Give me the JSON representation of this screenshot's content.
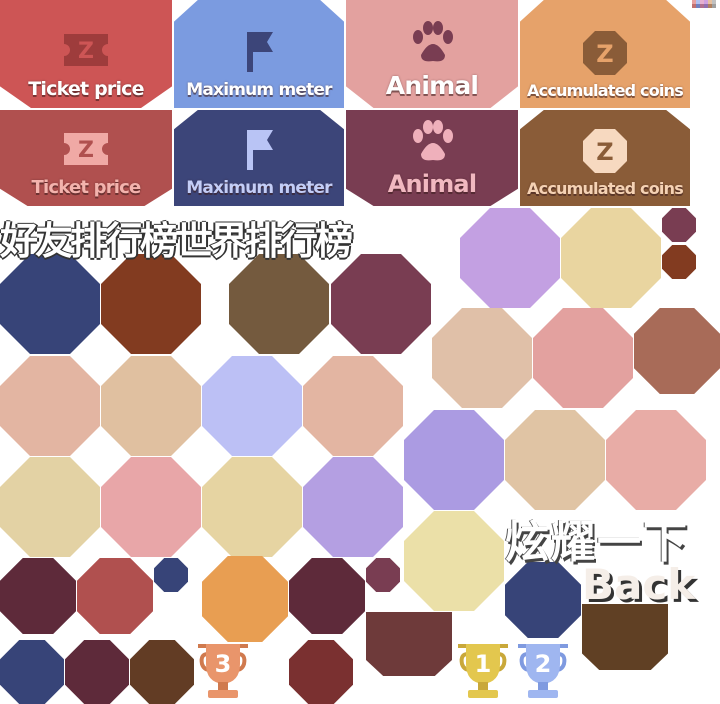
{
  "tiles": {
    "ticket_price": "Ticket price",
    "maximum_meter": "Maximum meter",
    "animal": "Animal",
    "accumulated_coins": "Accumulated coins",
    "ticket_price_2": "Ticket price",
    "maximum_meter_2": "Maximum meter",
    "animal_2": "Animal",
    "accumulated_coins_2": "Accumulated coins"
  },
  "banners": {
    "leaderboards": "好友排行榜世界排行榜",
    "show_off": "炫耀一下",
    "back": "Back"
  },
  "trophies": {
    "first": "1",
    "second": "2",
    "third": "3"
  },
  "colors": {
    "red": "#cd5555",
    "blue": "#7b9be0",
    "pink": "#e3a19f",
    "orange": "#e6a26a",
    "dark_red": "#b0504f",
    "navy": "#3c4579",
    "plum": "#793d52",
    "brown": "#8a5c38"
  },
  "icons": [
    "ticket-icon",
    "flag-icon",
    "paw-icon",
    "coin-icon",
    "trophy-icon"
  ]
}
